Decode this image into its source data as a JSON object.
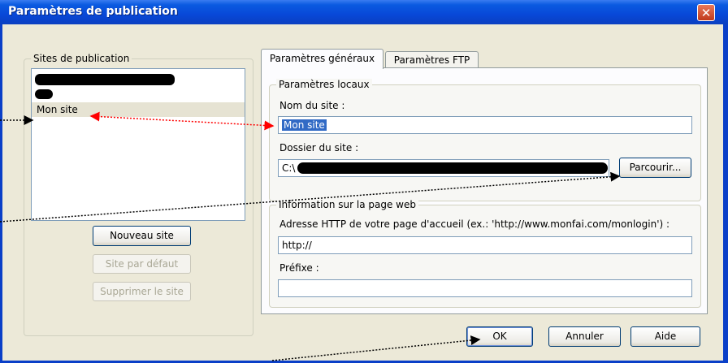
{
  "window": {
    "title": "Paramètres de publication",
    "close_glyph": "✕"
  },
  "sites_group": {
    "legend": "Sites de publication",
    "items": [
      {
        "label": "Mon site"
      }
    ],
    "new_site": "Nouveau site",
    "default_site": "Site par défaut",
    "delete_site": "Supprimer le site"
  },
  "tabs": [
    {
      "label": "Paramètres généraux"
    },
    {
      "label": "Paramètres FTP"
    }
  ],
  "local": {
    "legend": "Paramètres locaux",
    "site_name_label": "Nom du site :",
    "site_name_value": "Mon site",
    "site_folder_label": "Dossier du site :",
    "site_folder_value": "C:\\",
    "browse": "Parcourir..."
  },
  "web": {
    "legend": "Information sur la page web",
    "http_label": "Adresse HTTP de votre page d'accueil (ex.: 'http://www.monfai.com/monlogin') :",
    "http_value": "http://",
    "prefix_label": "Préfixe :",
    "prefix_value": ""
  },
  "footer": {
    "ok": "OK",
    "cancel": "Annuler",
    "help": "Aide"
  },
  "colors": {
    "titlebar": "#0a5ae0",
    "dialog_bg": "#ece9d8",
    "selection": "#316ac5",
    "annotation_red": "#ff0000"
  }
}
